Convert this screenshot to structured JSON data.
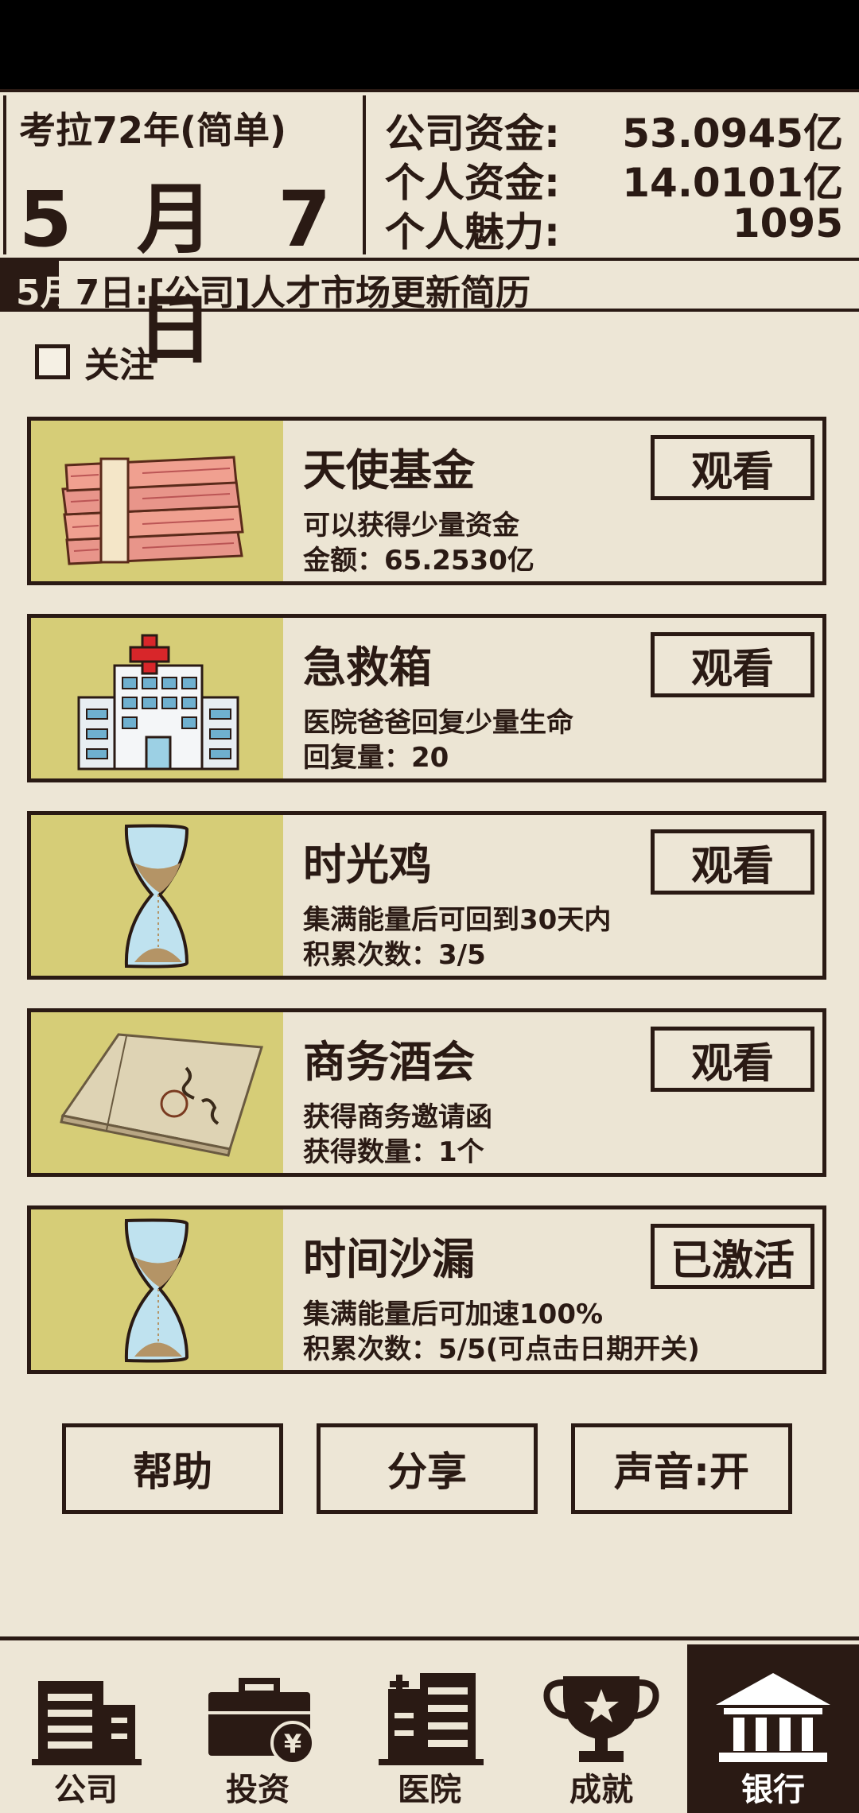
{
  "header": {
    "era": "考拉72年(简单)",
    "date": "5 月 7 日",
    "stats": [
      {
        "label": "公司资金:",
        "value": "53.0945亿"
      },
      {
        "label": "个人资金:",
        "value": "14.0101亿"
      },
      {
        "label": "个人魅力:",
        "value": "1095"
      }
    ]
  },
  "ticker": {
    "prefix": "5月",
    "text": "7日:[公司]人才市场更新简历"
  },
  "follow": {
    "label": "关注",
    "checked": false
  },
  "cards": [
    {
      "title": "天使基金",
      "line1": "可以获得少量资金",
      "line2": "金额：65.2530亿",
      "button": "观看",
      "icon": "money-stack-icon"
    },
    {
      "title": "急救箱",
      "line1": "医院爸爸回复少量生命",
      "line2": "回复量：20",
      "button": "观看",
      "icon": "hospital-icon"
    },
    {
      "title": "时光鸡",
      "line1": "集满能量后可回到30天内",
      "line2": "积累次数：3/5",
      "button": "观看",
      "icon": "hourglass-icon"
    },
    {
      "title": "商务酒会",
      "line1": "获得商务邀请函",
      "line2": "获得数量：1个",
      "button": "观看",
      "icon": "invitation-icon"
    },
    {
      "title": "时间沙漏",
      "line1": "集满能量后可加速100%",
      "line2": "积累次数：5/5(可点击日期开关)",
      "button": "已激活",
      "icon": "hourglass-icon"
    }
  ],
  "actions": {
    "help": "帮助",
    "share": "分享",
    "sound": "声音:开"
  },
  "tabs": [
    {
      "label": "公司",
      "icon": "building-icon"
    },
    {
      "label": "投资",
      "icon": "briefcase-yen-icon"
    },
    {
      "label": "医院",
      "icon": "hospital-building-icon"
    },
    {
      "label": "成就",
      "icon": "trophy-icon"
    },
    {
      "label": "银行",
      "icon": "bank-icon",
      "active": true
    }
  ],
  "colors": {
    "ink": "#2a1a14",
    "paper": "#ede6d6",
    "card_image_bg": "#d6cd77"
  }
}
